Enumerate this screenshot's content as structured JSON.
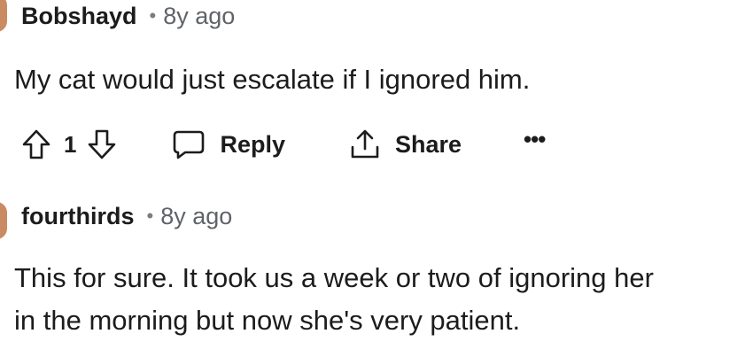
{
  "comments": [
    {
      "author": "Bobshayd",
      "separator": "•",
      "age": "8y ago",
      "body": "My cat would just escalate if I ignored him.",
      "actions": {
        "upvote_icon": "arrow-up-icon",
        "vote_count": "1",
        "downvote_icon": "arrow-down-icon",
        "reply_label": "Reply",
        "reply_icon": "speech-bubble-icon",
        "share_label": "Share",
        "share_icon": "share-icon",
        "more_label": "•••"
      }
    },
    {
      "author": "fourthirds",
      "separator": "•",
      "age": "8y ago",
      "body_line_1": "This for sure. It took us a week or two of ignoring her",
      "body_line_2": "in the morning but now she's very patient."
    }
  ],
  "colors": {
    "avatar": "#c98c62",
    "meta_text": "#5f6368",
    "text": "#1c1c1c"
  }
}
